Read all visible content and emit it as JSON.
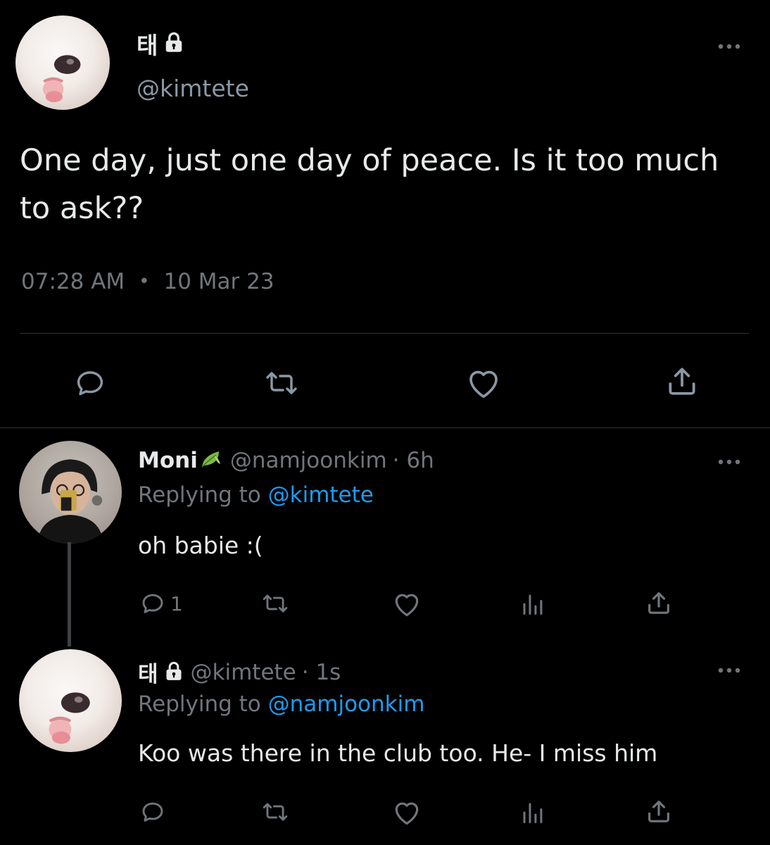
{
  "tweet": {
    "display_name": "태",
    "handle": "@kimtete",
    "text": "One day, just one day of peace. Is it too much to ask??",
    "time": "07:28 AM",
    "separator": "•",
    "date": "10 Mar 23"
  },
  "replies": [
    {
      "display_name": "Moni",
      "handle": "@namjoonkim",
      "time": "· 6h",
      "replying_label": "Replying to",
      "replying_to": "@kimtete",
      "text": "oh babie :(",
      "reply_count": "1"
    },
    {
      "display_name": "태",
      "handle": "@kimtete",
      "time": "· 1s",
      "replying_label": "Replying to",
      "replying_to": "@namjoonkim",
      "text": "Koo was there in the club too. He- I miss him",
      "reply_count": ""
    }
  ],
  "colors": {
    "background": "#000000",
    "text_primary": "#e7e9ea",
    "text_secondary": "#71767b",
    "mention": "#1d9bf0",
    "divider": "#2f3336"
  },
  "icons": {
    "reply": "reply-icon",
    "retweet": "retweet-icon",
    "like": "heart-icon",
    "views": "views-icon",
    "share": "share-icon",
    "more": "more-icon",
    "lock": "lock-icon",
    "leaf": "leaf-icon"
  }
}
